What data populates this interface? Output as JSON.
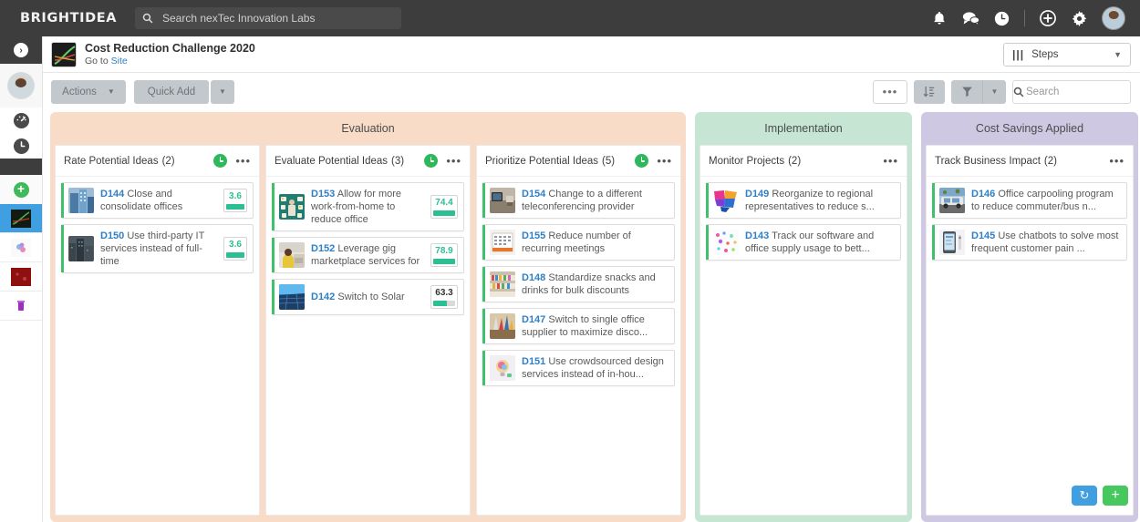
{
  "topbar": {
    "brand": "BRIGHTIDEA",
    "search": {
      "placeholder": "Search nexTec Innovation Labs",
      "value": ""
    },
    "icons": [
      {
        "name": "bell-icon",
        "label": "Notifications"
      },
      {
        "name": "chat-icon",
        "label": "Messages"
      },
      {
        "name": "clock-icon",
        "label": "Recent"
      },
      {
        "name": "plus-circle-icon",
        "label": "Create"
      },
      {
        "name": "gear-icon",
        "label": "Settings"
      },
      {
        "name": "user-avatar",
        "label": "Account"
      }
    ]
  },
  "rail": {
    "expand_label": "›",
    "items": [
      {
        "name": "rail-avatar",
        "label": "Profile"
      },
      {
        "name": "dashboard-icon",
        "label": "Dashboard"
      },
      {
        "name": "clock-icon",
        "label": "Recent"
      },
      {
        "name": "add-icon",
        "label": "Add"
      },
      {
        "name": "site-cost-reduction",
        "label": "Cost Reduction Challenge 2020"
      },
      {
        "name": "site-two",
        "label": "Site 2"
      },
      {
        "name": "site-three",
        "label": "Site 3"
      },
      {
        "name": "site-four",
        "label": "Site 4"
      }
    ]
  },
  "header": {
    "title": "Cost Reduction Challenge 2020",
    "subtitle_prefix": "Go to ",
    "subtitle_link": "Site",
    "view_select": {
      "label": "Steps",
      "icon": "columns-icon",
      "caret": "⌄"
    }
  },
  "toolbar": {
    "actions_label": "Actions",
    "quickadd_label": "Quick Add",
    "caret": "▾",
    "more_label": "•••",
    "sort_label": "sort-icon",
    "filter_label": "filter-icon",
    "search": {
      "placeholder": "Search",
      "value": ""
    }
  },
  "board": {
    "lanes": [
      {
        "title": "Evaluation",
        "key": "evaluation",
        "color": "#f8dcc8",
        "columns": [
          {
            "name": "Rate Potential Ideas",
            "count": "(2)",
            "has_clock": true,
            "dots": "•••",
            "cards": [
              {
                "id": "D144",
                "text": "Close and consolidate offices",
                "score": "3.6",
                "score_pct": 100,
                "score_color": "#2bbf93",
                "thumb": "building"
              },
              {
                "id": "D150",
                "text": "Use third-party IT services instead of full-time",
                "score": "3.6",
                "score_pct": 100,
                "score_color": "#2bbf93",
                "thumb": "city"
              }
            ]
          },
          {
            "name": "Evaluate Potential Ideas",
            "count": "(3)",
            "has_clock": true,
            "dots": "•••",
            "cards": [
              {
                "id": "D153",
                "text": "Allow for more work-from-home to reduce office",
                "score": "74.4",
                "score_pct": 100,
                "score_color": "#2bbf93",
                "thumb": "desk"
              },
              {
                "id": "D152",
                "text": "Leverage gig marketplace services for",
                "score": "78.9",
                "score_pct": 100,
                "score_color": "#2bbf93",
                "thumb": "person"
              },
              {
                "id": "D142",
                "text": "Switch to Solar",
                "score": "63.3",
                "score_pct": 63,
                "score_color": "#2bbf93",
                "thumb": "solar"
              }
            ]
          },
          {
            "name": "Prioritize Potential Ideas",
            "count": "(5)",
            "has_clock": true,
            "dots": "•••",
            "cards": [
              {
                "id": "D154",
                "text": "Change to a different teleconferencing provider",
                "score": "",
                "thumb": "monitor"
              },
              {
                "id": "D155",
                "text": "Reduce number of recurring meetings",
                "score": "",
                "thumb": "calendar"
              },
              {
                "id": "D148",
                "text": "Standardize snacks and drinks for bulk discounts",
                "score": "",
                "thumb": "shelf"
              },
              {
                "id": "D147",
                "text": "Switch to single office supplier to maximize disco...",
                "score": "",
                "thumb": "supplies"
              },
              {
                "id": "D151",
                "text": "Use crowdsourced design services instead of in-hou...",
                "score": "",
                "thumb": "bulb"
              }
            ]
          }
        ]
      },
      {
        "title": "Implementation",
        "key": "implementation",
        "color": "#c6e6d3",
        "columns": [
          {
            "name": "Monitor Projects",
            "count": "(2)",
            "has_clock": false,
            "dots": "•••",
            "cards": [
              {
                "id": "D149",
                "text": "Reorganize to regional representatives to reduce s...",
                "score": "",
                "thumb": "map"
              },
              {
                "id": "D143",
                "text": "Track our software and office supply usage to bett...",
                "score": "",
                "thumb": "confetti"
              }
            ]
          }
        ]
      },
      {
        "title": "Cost Savings Applied",
        "key": "cost_savings",
        "color": "#cfc8e2",
        "columns": [
          {
            "name": "Track Business Impact",
            "count": "(2)",
            "has_clock": false,
            "dots": "•••",
            "cards": [
              {
                "id": "D146",
                "text": "Office carpooling program to reduce commuter/bus n...",
                "score": "",
                "thumb": "car"
              },
              {
                "id": "D145",
                "text": "Use chatbots to solve most frequent customer pain ...",
                "score": "",
                "thumb": "phone"
              }
            ]
          }
        ]
      }
    ]
  },
  "fabs": [
    {
      "name": "refresh-fab",
      "glyph": "↻",
      "color": "#3f9fe0"
    },
    {
      "name": "add-fab",
      "glyph": "+",
      "color": "#46c85f"
    }
  ]
}
